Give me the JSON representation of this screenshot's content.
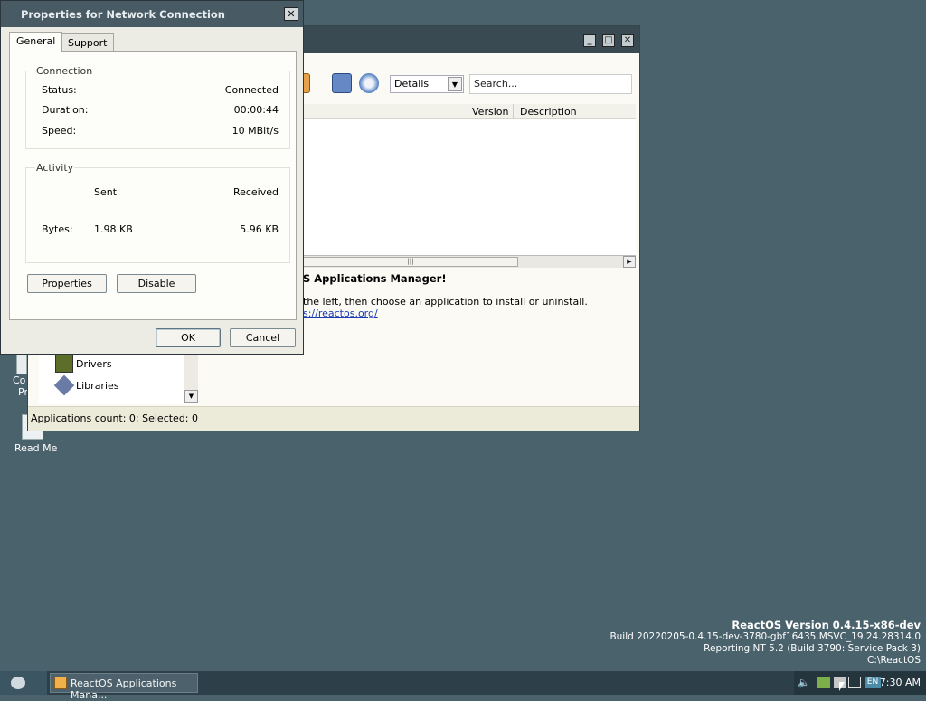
{
  "desktop": {
    "icons": [
      {
        "label": "Read Me"
      }
    ],
    "partial_labels": [
      "Co",
      "Pr"
    ]
  },
  "build_info": {
    "line1": "ReactOS Version 0.4.15-x86-dev",
    "line2": "Build 20220205-0.4.15-dev-3780-gbf16435.MSVC_19.24.28314.0",
    "line3": "Reporting NT 5.2 (Build 3790: Service Pack 3)",
    "line4": "C:\\ReactOS"
  },
  "app_window": {
    "view_select": {
      "value": "Details"
    },
    "search": {
      "placeholder": "Search..."
    },
    "columns": [
      "Version",
      "Description"
    ],
    "info": {
      "heading": "S Applications Manager!",
      "text": "the left, then choose an application to install or uninstall.",
      "link": "s://reactos.org/"
    },
    "tree_items": [
      "Drivers",
      "Libraries"
    ],
    "status": "Applications count: 0; Selected: 0"
  },
  "dialog": {
    "title": "Properties for Network Connection",
    "tabs": [
      "General",
      "Support"
    ],
    "connection": {
      "legend": "Connection",
      "rows": [
        {
          "label": "Status:",
          "value": "Connected"
        },
        {
          "label": "Duration:",
          "value": "00:00:44"
        },
        {
          "label": "Speed:",
          "value": "10 MBit/s"
        }
      ]
    },
    "activity": {
      "legend": "Activity",
      "sent_header": "Sent",
      "received_header": "Received",
      "bytes_label": "Bytes:",
      "bytes_sent": "1.98 KB",
      "bytes_received": "5.96 KB"
    },
    "properties_button": "Properties",
    "disable_button": "Disable",
    "ok_button": "OK",
    "cancel_button": "Cancel"
  },
  "taskbar": {
    "task_label": "ReactOS Applications Mana...",
    "lang": "EN",
    "clock": "7:30 AM"
  },
  "colors": {
    "desktop": "#4a626c",
    "taskbar": "#2d3f48",
    "titlebar": "#485a63"
  }
}
